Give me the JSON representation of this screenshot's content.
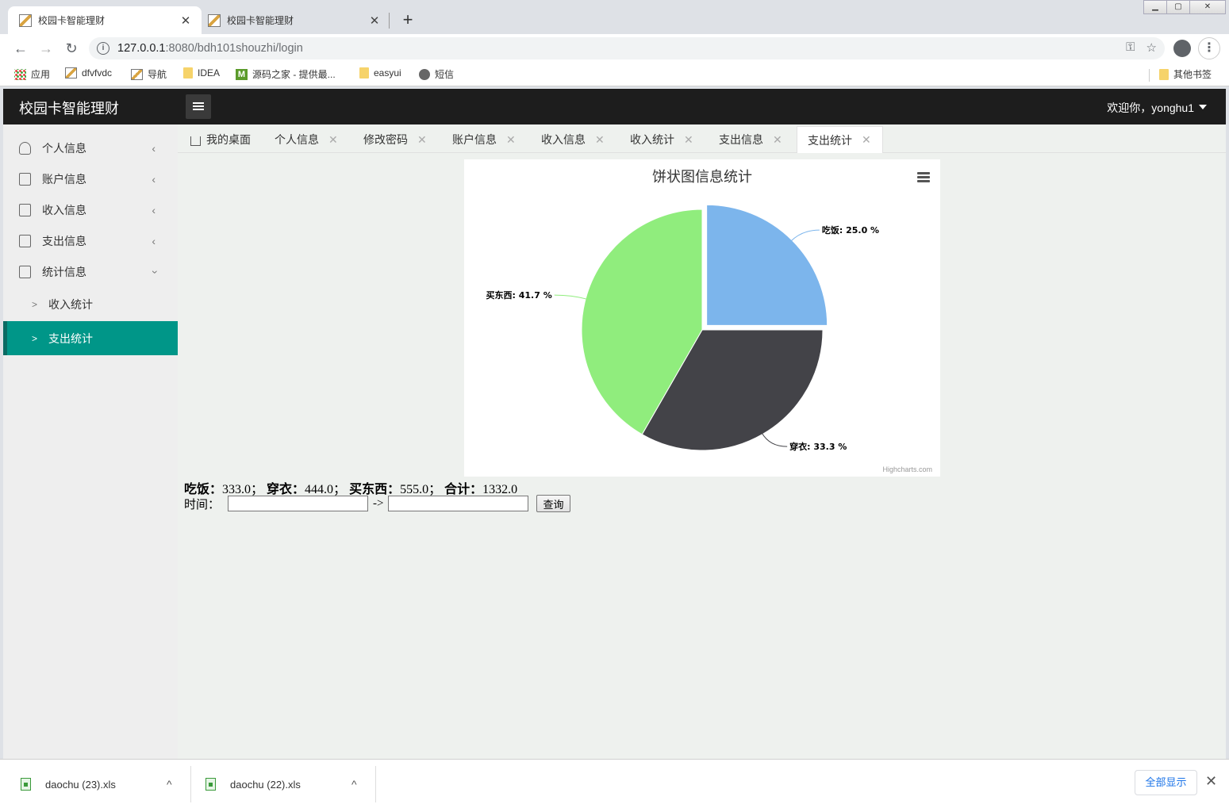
{
  "browser": {
    "tabs": [
      {
        "title": "校园卡智能理财"
      },
      {
        "title": "校园卡智能理财"
      }
    ],
    "url_host": "127.0.0.1",
    "url_rest": ":8080/bdh101shouzhi/login",
    "bookmarks": [
      "应用",
      "dfvfvdc",
      "导航",
      "IDEA",
      "源码之家 - 提供最...",
      "easyui",
      "短信"
    ],
    "other_bookmarks": "其他书签"
  },
  "app": {
    "brand": "校园卡智能理财",
    "welcome": "欢迎你，yonghu1"
  },
  "sidebar": {
    "items": [
      {
        "label": "个人信息",
        "icon": "user-icon"
      },
      {
        "label": "账户信息",
        "icon": "file-icon"
      },
      {
        "label": "收入信息",
        "icon": "file-icon"
      },
      {
        "label": "支出信息",
        "icon": "file-icon"
      },
      {
        "label": "统计信息",
        "icon": "file-icon"
      }
    ],
    "sub": [
      {
        "label": "收入统计"
      },
      {
        "label": "支出统计"
      }
    ]
  },
  "page_tabs": [
    "我的桌面",
    "个人信息",
    "修改密码",
    "账户信息",
    "收入信息",
    "收入统计",
    "支出信息",
    "支出统计"
  ],
  "chart_data": {
    "type": "pie",
    "title": "饼状图信息统计",
    "slices": [
      {
        "name": "吃饭",
        "value": 25.0,
        "label": "吃饭: 25.0 %",
        "color": "#7cb5ec",
        "sliced": true
      },
      {
        "name": "穿衣",
        "value": 33.3,
        "label": "穿衣: 33.3 %",
        "color": "#434348"
      },
      {
        "name": "买东西",
        "value": 41.7,
        "label": "买东西: 41.7 %",
        "color": "#90ed7d"
      }
    ],
    "credits": "Highcharts.com"
  },
  "summary": {
    "eat_label": "吃饭：",
    "eat_value": "333.0",
    "sep": "；",
    "clothes_label": "穿衣：",
    "clothes_value": "444.0",
    "shop_label": "买东西：",
    "shop_value": "555.0",
    "total_label": "合计：",
    "total_value": "1332.0"
  },
  "query": {
    "time_label": "时间：",
    "arrow": "->",
    "button": "查询"
  },
  "downloads": [
    {
      "name": "daochu (23).xls"
    },
    {
      "name": "daochu (22).xls"
    }
  ],
  "download_bar": {
    "show_all": "全部显示"
  }
}
